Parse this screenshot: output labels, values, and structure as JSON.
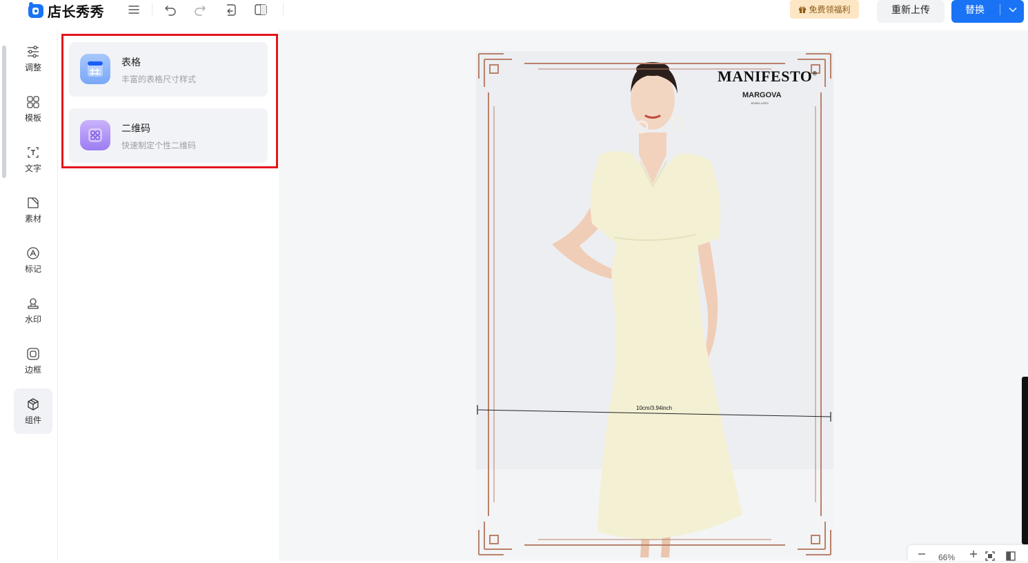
{
  "app": {
    "name": "店长秀秀"
  },
  "toolbar": {
    "menu_icon": "menu-icon",
    "undo_icon": "undo-icon",
    "redo_icon": "redo-icon",
    "restore_icon": "restore-icon",
    "compare_icon": "compare-icon"
  },
  "header": {
    "promo_label": "免费领福利",
    "reupload_label": "重新上传",
    "replace_label": "替换"
  },
  "sidebar": {
    "items": [
      {
        "label": "调整",
        "icon": "sliders-icon"
      },
      {
        "label": "模板",
        "icon": "template-icon"
      },
      {
        "label": "文字",
        "icon": "text-icon"
      },
      {
        "label": "素材",
        "icon": "material-icon"
      },
      {
        "label": "标记",
        "icon": "mark-icon"
      },
      {
        "label": "水印",
        "icon": "watermark-icon"
      },
      {
        "label": "边框",
        "icon": "border-icon"
      },
      {
        "label": "组件",
        "icon": "component-icon",
        "active": true
      }
    ]
  },
  "panel": {
    "cards": [
      {
        "title": "表格",
        "subtitle": "丰富的表格尺寸样式",
        "icon": "table-icon"
      },
      {
        "title": "二维码",
        "subtitle": "快速制定个性二维码",
        "icon": "qrcode-icon"
      }
    ]
  },
  "canvas": {
    "brand": "MANIFESTO",
    "brand_mark": "®",
    "sub_brand": "MARGOVA",
    "sub_brand_tag": "JEWELLERY",
    "measure_label": "10cm/3.94inch"
  },
  "zoom": {
    "value": "66%"
  },
  "colors": {
    "accent": "#1a73f5",
    "highlight": "#e3141c",
    "frame": "#b9806a",
    "promo_bg": "#fde6c3"
  }
}
